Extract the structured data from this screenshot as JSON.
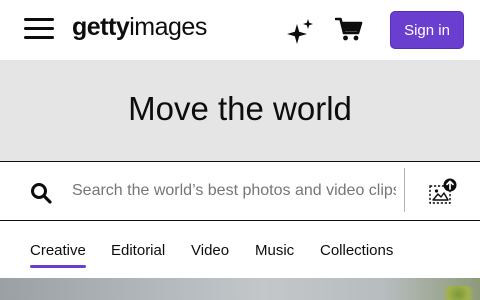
{
  "header": {
    "menu_icon": "hamburger-menu-icon",
    "logo": {
      "bold": "getty",
      "regular": "images"
    },
    "ai_icon": "sparkle-icon",
    "cart_icon": "shopping-cart-icon",
    "signin_label": "Sign in"
  },
  "hero": {
    "title": "Move the world"
  },
  "search": {
    "search_icon": "magnifier-icon",
    "placeholder": "Search the world’s best photos and video clips",
    "value": "",
    "image_search_icon": "search-by-image-icon"
  },
  "tabs": [
    {
      "label": "Creative",
      "active": true
    },
    {
      "label": "Editorial",
      "active": false
    },
    {
      "label": "Video",
      "active": false
    },
    {
      "label": "Music",
      "active": false
    },
    {
      "label": "Collections",
      "active": false
    }
  ],
  "colors": {
    "accent": "#6a3fd0",
    "text": "#0c0d0d",
    "hero_bg": "#e5e5e5",
    "placeholder": "#767676"
  }
}
